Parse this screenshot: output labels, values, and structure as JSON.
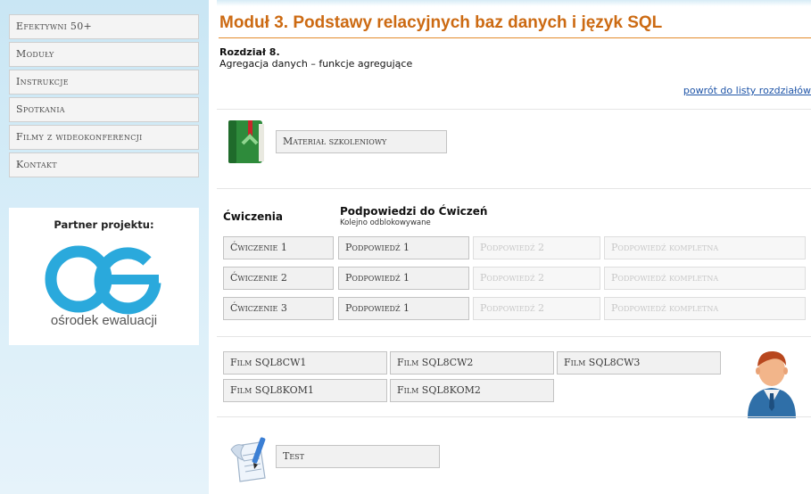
{
  "sidebar": {
    "items": [
      {
        "label": "Efektywni 50+"
      },
      {
        "label": "Moduły"
      },
      {
        "label": "Instrukcje"
      },
      {
        "label": "Spotkania"
      },
      {
        "label": "Filmy z wideokonferencji"
      },
      {
        "label": "Kontakt"
      }
    ],
    "partner": {
      "title": "Partner projektu:",
      "logo_caption": "ośrodek ewaluacji",
      "logo_color": "#2aa9dc"
    }
  },
  "header": {
    "title": "Moduł 3. Podstawy relacyjnych baz danych i język SQL",
    "accent_color": "#cc6a12"
  },
  "chapter": {
    "title": "Rozdział 8.",
    "subtitle": "Agregacja danych – funkcje agregujące",
    "back_link": "powrót do listy rozdziałów"
  },
  "material": {
    "icon": "green-book-icon",
    "button_label": "Materiał szkoleniowy"
  },
  "exercises": {
    "heading": "Ćwiczenia",
    "hints_heading": "Podpowiedzi do Ćwiczeń",
    "hints_note": "Kolejno odblokowywane",
    "rows": [
      {
        "exercise": "Ćwiczenie 1",
        "hint1": "Podpowiedź 1",
        "hint2": "Podpowiedź 2",
        "full": "Podpowiedź kompletna"
      },
      {
        "exercise": "Ćwiczenie 2",
        "hint1": "Podpowiedź 1",
        "hint2": "Podpowiedź 2",
        "full": "Podpowiedź kompletna"
      },
      {
        "exercise": "Ćwiczenie 3",
        "hint1": "Podpowiedź 1",
        "hint2": "Podpowiedź 2",
        "full": "Podpowiedź kompletna"
      }
    ]
  },
  "films": {
    "icon": "presenter-avatar-icon",
    "items": [
      {
        "label": "Film SQL8CW1"
      },
      {
        "label": "Film SQL8CW2"
      },
      {
        "label": "Film SQL8CW3"
      },
      {
        "label": "Film SQL8KOM1"
      },
      {
        "label": "Film SQL8KOM2"
      }
    ]
  },
  "test": {
    "icon": "document-pen-icon",
    "button_label": "Test"
  }
}
